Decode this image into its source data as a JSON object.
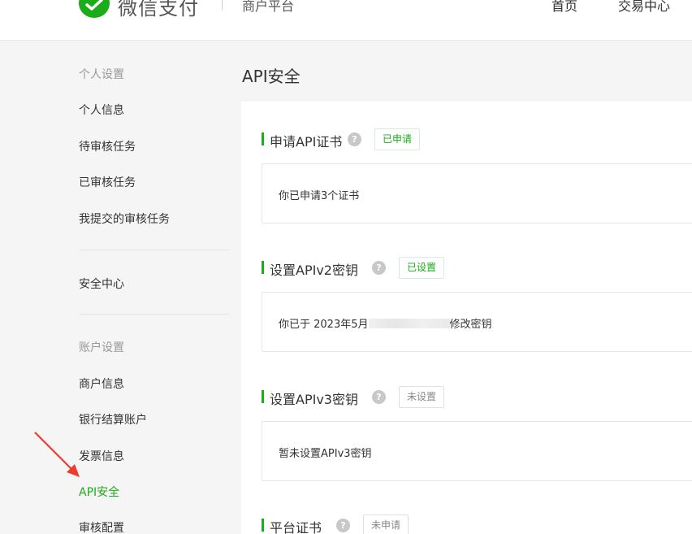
{
  "header": {
    "logo_text": "微信支付",
    "subtitle": "商户平台",
    "nav": [
      "首页",
      "交易中心"
    ],
    "brand_color": "#1aad19"
  },
  "sidebar": {
    "group_personal": "个人设置",
    "personal_items": [
      "个人信息",
      "待审核任务",
      "已审核任务",
      "我提交的审核任务"
    ],
    "security_center": "安全中心",
    "group_account": "账户设置",
    "account_items": [
      "商户信息",
      "银行结算账户",
      "发票信息",
      "API安全",
      "审核配置"
    ],
    "active_item": "API安全"
  },
  "main": {
    "title": "API安全",
    "sections": [
      {
        "title": "申请API证书",
        "badge": "已申请",
        "badge_state": "done",
        "content": "你已申请3个证书"
      },
      {
        "title": "设置APIv2密钥",
        "badge": "已设置",
        "badge_state": "done",
        "content_prefix": "你已于 2023年5月",
        "content_suffix": "修改密钥"
      },
      {
        "title": "设置APIv3密钥",
        "badge": "未设置",
        "badge_state": "none",
        "content": "暂未设置APIv3密钥"
      },
      {
        "title": "平台证书",
        "badge": "未申请",
        "badge_state": "none"
      }
    ]
  }
}
